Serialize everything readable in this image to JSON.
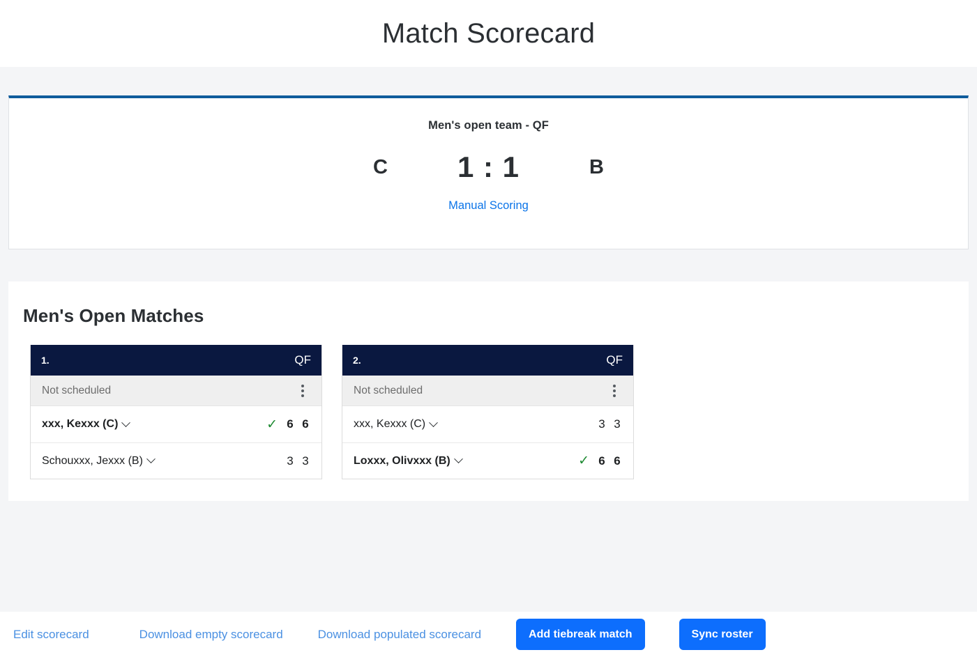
{
  "page": {
    "title": "Match Scorecard"
  },
  "scoreboard": {
    "subtitle": "Men's open team - QF",
    "home_team": "C",
    "away_team": "B",
    "score": "1 : 1",
    "manual_scoring_label": "Manual Scoring",
    "accent_color": "#0f5c9c",
    "link_color": "#0b74e8"
  },
  "matches_section": {
    "heading": "Men's Open Matches",
    "cards": [
      {
        "number": "1.",
        "round": "QF",
        "schedule": "Not scheduled",
        "players": [
          {
            "name": "xxx, Kexxx (C)",
            "winner": true,
            "check": "✓",
            "sets": [
              "6",
              "6"
            ]
          },
          {
            "name": "Schouxxx, Jexxx (B)",
            "winner": false,
            "check": "",
            "sets": [
              "3",
              "3"
            ]
          }
        ]
      },
      {
        "number": "2.",
        "round": "QF",
        "schedule": "Not scheduled",
        "players": [
          {
            "name": "xxx, Kexxx (C)",
            "winner": false,
            "check": "",
            "sets": [
              "3",
              "3"
            ]
          },
          {
            "name": "Loxxx, Olivxxx (B)",
            "winner": true,
            "check": "✓",
            "sets": [
              "6",
              "6"
            ]
          }
        ]
      }
    ]
  },
  "footer": {
    "links": [
      {
        "label": "Edit scorecard"
      },
      {
        "label": "Download empty scorecard"
      },
      {
        "label": "Download populated scorecard"
      }
    ],
    "buttons": [
      {
        "label": "Add tiebreak match"
      },
      {
        "label": "Sync roster"
      }
    ],
    "button_color": "#0d6efd",
    "link_color": "#4a90e2"
  }
}
